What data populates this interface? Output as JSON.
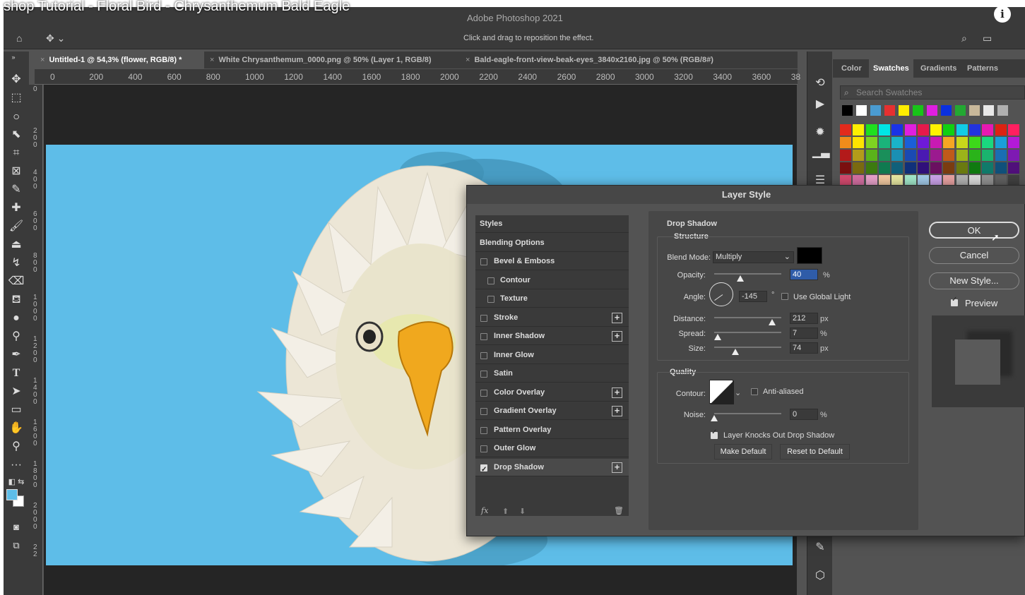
{
  "video_title": "shop Tutorial - Floral Bird - Chrysanthemum Bald Eagle",
  "app_title": "Adobe Photoshop 2021",
  "options_hint": "Click and drag to reposition the effect.",
  "doc_tabs": [
    {
      "label": "Untitled-1 @ 54,3% (flower, RGB/8) *"
    },
    {
      "label": "White Chrysanthemum_0000.png @ 50% (Layer 1, RGB/8)"
    },
    {
      "label": "Bald-eagle-front-view-beak-eyes_3840x2160.jpg @ 50% (RGB/8#)"
    }
  ],
  "ruler_top": [
    "0",
    "200",
    "400",
    "600",
    "800",
    "1000",
    "1200",
    "1400",
    "1600",
    "1800",
    "2000",
    "2200",
    "2400",
    "2600",
    "2800",
    "3000",
    "3200",
    "3400",
    "3600",
    "38"
  ],
  "ruler_left": [
    "0",
    "2\n0\n0",
    "4\n0\n0",
    "6\n0\n0",
    "8\n0\n0",
    "1\n0\n0\n0",
    "1\n2\n0\n0",
    "1\n4\n0\n0",
    "1\n6\n0\n0",
    "1\n8\n0\n0",
    "2\n0\n0\n0",
    "2\n2"
  ],
  "swatches_panel": {
    "tabs": [
      "Color",
      "Swatches",
      "Gradients",
      "Patterns"
    ],
    "active_tab": "Swatches",
    "search_placeholder": "Search Swatches",
    "recent": [
      "#000000",
      "#ffffff",
      "#4a9bd1",
      "#e63030",
      "#ffee00",
      "#18c418",
      "#e01ee0",
      "#0a30e0",
      "#23a832",
      "#c8b89a",
      "#e8e8e8",
      "#b0b0b0"
    ],
    "grid_rows": [
      [
        "#e22a1c",
        "#ffef00",
        "#1fe01f",
        "#00e6e6",
        "#1a33e6",
        "#e01fe0",
        "#e6194b",
        "#fff200",
        "#11d011",
        "#11cbe6",
        "#2233dd",
        "#e619b2",
        "#dd2211",
        "#ff1f60"
      ],
      [
        "#f08c1a",
        "#ffe300",
        "#7ed321",
        "#1ab37a",
        "#1ab3c8",
        "#1a5fd8",
        "#6e1ad8",
        "#c81ab3",
        "#f5a623",
        "#c8d81a",
        "#3dd81a",
        "#1ad87f",
        "#1a9fd8",
        "#b31ad8"
      ],
      [
        "#b31a1a",
        "#b39b1a",
        "#5ab31a",
        "#1a8f5a",
        "#1a8fb3",
        "#1a4ab3",
        "#4a1ab3",
        "#9b1a8f",
        "#c05a1a",
        "#9bb31a",
        "#2ab31a",
        "#1ab36e",
        "#1a6eb3",
        "#7e1ab3"
      ],
      [
        "#7a1010",
        "#7a6a10",
        "#3c7a10",
        "#107a50",
        "#10607a",
        "#10307a",
        "#30107a",
        "#6a1060",
        "#7a3c10",
        "#6a7a10",
        "#107a10",
        "#107a6a",
        "#10507a",
        "#50107a"
      ],
      [
        "#d24a6e",
        "#d26ea0",
        "#e6a0c8",
        "#f0c8a0",
        "#e6e6a0",
        "#a0e6c8",
        "#a0c8e6",
        "#c8a0e6",
        "#e6a0a0",
        "#b0b0b0",
        "#d8d8d8",
        "#909090",
        "#606060",
        "#404040"
      ]
    ]
  },
  "dialog": {
    "title": "Layer Style",
    "styles": [
      {
        "label": "Styles",
        "checkbox": false,
        "checked": false,
        "plus": false,
        "header": true
      },
      {
        "label": "Blending Options",
        "checkbox": false,
        "checked": false,
        "plus": false,
        "header": true
      },
      {
        "label": "Bevel & Emboss",
        "checkbox": true,
        "checked": false,
        "plus": false
      },
      {
        "label": "Contour",
        "checkbox": true,
        "checked": false,
        "plus": false,
        "indent": true
      },
      {
        "label": "Texture",
        "checkbox": true,
        "checked": false,
        "plus": false,
        "indent": true
      },
      {
        "label": "Stroke",
        "checkbox": true,
        "checked": false,
        "plus": true
      },
      {
        "label": "Inner Shadow",
        "checkbox": true,
        "checked": false,
        "plus": true
      },
      {
        "label": "Inner Glow",
        "checkbox": true,
        "checked": false,
        "plus": false
      },
      {
        "label": "Satin",
        "checkbox": true,
        "checked": false,
        "plus": false
      },
      {
        "label": "Color Overlay",
        "checkbox": true,
        "checked": false,
        "plus": true
      },
      {
        "label": "Gradient Overlay",
        "checkbox": true,
        "checked": false,
        "plus": true
      },
      {
        "label": "Pattern Overlay",
        "checkbox": true,
        "checked": false,
        "plus": false
      },
      {
        "label": "Outer Glow",
        "checkbox": true,
        "checked": false,
        "plus": false
      },
      {
        "label": "Drop Shadow",
        "checkbox": true,
        "checked": true,
        "plus": true,
        "active": true
      }
    ],
    "footer_fx": "fx",
    "drop_shadow": {
      "group_title": "Drop Shadow",
      "structure_title": "Structure",
      "blend_mode_label": "Blend Mode:",
      "blend_mode_value": "Multiply",
      "shadow_color": "#000000",
      "opacity_label": "Opacity:",
      "opacity_value": "40",
      "opacity_unit": "%",
      "angle_label": "Angle:",
      "angle_value": "-145",
      "angle_unit": "°",
      "use_global_light_label": "Use Global Light",
      "use_global_light_checked": false,
      "distance_label": "Distance:",
      "distance_value": "212",
      "distance_unit": "px",
      "spread_label": "Spread:",
      "spread_value": "7",
      "spread_unit": "%",
      "size_label": "Size:",
      "size_value": "74",
      "size_unit": "px",
      "quality_title": "Quality",
      "contour_label": "Contour:",
      "anti_aliased_label": "Anti-aliased",
      "anti_aliased_checked": false,
      "noise_label": "Noise:",
      "noise_value": "0",
      "noise_unit": "%",
      "knockout_label": "Layer Knocks Out Drop Shadow",
      "knockout_checked": true,
      "make_default_label": "Make Default",
      "reset_default_label": "Reset to Default"
    },
    "ok_label": "OK",
    "cancel_label": "Cancel",
    "new_style_label": "New Style...",
    "preview_label": "Preview",
    "preview_checked": true
  }
}
